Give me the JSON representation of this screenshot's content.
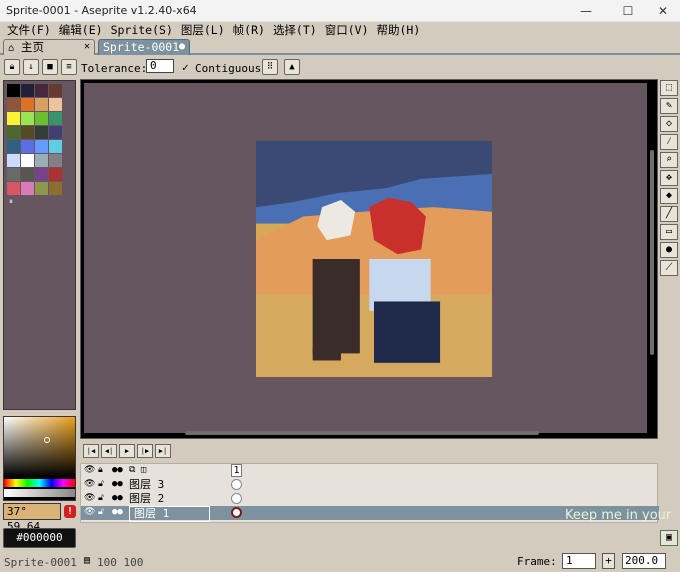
{
  "window": {
    "title": "Sprite-0001 - Aseprite v1.2.40-x64",
    "controls": [
      "—",
      "☐",
      "✕"
    ]
  },
  "menu": [
    "文件(F)",
    "编辑(E)",
    "Sprite(S)",
    "图层(L)",
    "帧(R)",
    "选择(T)",
    "窗口(V)",
    "帮助(H)"
  ],
  "tabs": {
    "home": "主页",
    "sprite": "Sprite-0001"
  },
  "toolbar": {
    "tolerance_label": "Tolerance:",
    "tolerance_value": "0",
    "contiguous_label": "Contiguous",
    "contiguous_checked": true
  },
  "colors": {
    "bg": "#d3cbbe",
    "canvas_bg": "#655660",
    "accent": "#7d929e"
  },
  "palette": [
    "#000000",
    "#222034",
    "#45283c",
    "#663931",
    "#8f563b",
    "#df7126",
    "#d9a066",
    "#eec39a",
    "#fbf236",
    "#99e550",
    "#6abe30",
    "#37946e",
    "#4b692f",
    "#524b24",
    "#323c39",
    "#3f3f74",
    "#306082",
    "#5b6ee1",
    "#639bff",
    "#5fcde4",
    "#cbdbfc",
    "#ffffff",
    "#9badb7",
    "#847e87",
    "#696a6a",
    "#595652",
    "#76428a",
    "#ac3232",
    "#d95763",
    "#d77bba",
    "#8f974a",
    "#8a6f30"
  ],
  "color": {
    "fg_info": "37° 59,64",
    "hex": "#000000"
  },
  "layers": [
    {
      "name": "",
      "frame_header": "1"
    },
    {
      "name": "图层 3"
    },
    {
      "name": "图层 2"
    },
    {
      "name": "图层 1",
      "selected": true
    }
  ],
  "status": {
    "sprite_name": "Sprite-0001",
    "size": "100 100",
    "frame_label": "Frame:",
    "frame_value": "1",
    "zoom": "200.0",
    "overlay_text": "Keep me in your"
  }
}
